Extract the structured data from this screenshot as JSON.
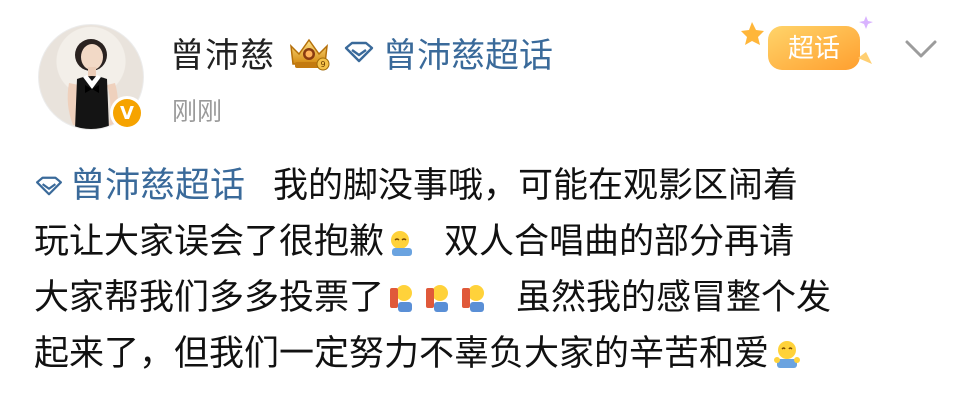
{
  "header": {
    "username": "曾沛慈",
    "topic_link": "曾沛慈超话",
    "timestamp": "刚刚",
    "verified_badge": "V",
    "super_topic_badge": "超话"
  },
  "post": {
    "topic_tag": "曾沛慈超话",
    "line1_text": "我的脚没事哦，可能在观影区闹着",
    "line2_text_a": "玩让大家误会了很抱歉",
    "line2_text_b": "双人合唱曲的部分再请",
    "line3_text_a": "大家帮我们多多投票了",
    "line3_text_b": "虽然我的感冒整个发",
    "line4_text": "起来了，但我们一定努力不辜负大家的辛苦和爱"
  },
  "colors": {
    "link": "#3a6a9a",
    "text": "#111111",
    "muted": "#9a9a9a",
    "verified": "#f6a300",
    "super_topic": "#ffb23f"
  },
  "icons": {
    "level_badge": "crown-level-badge-icon",
    "topic": "diamond-topic-icon",
    "chevron": "chevron-down-icon",
    "sorry_emoji": "bowing-emoji-icon",
    "vote_emoji": "cheering-emoji-icon",
    "hug_emoji": "hug-emoji-icon"
  }
}
